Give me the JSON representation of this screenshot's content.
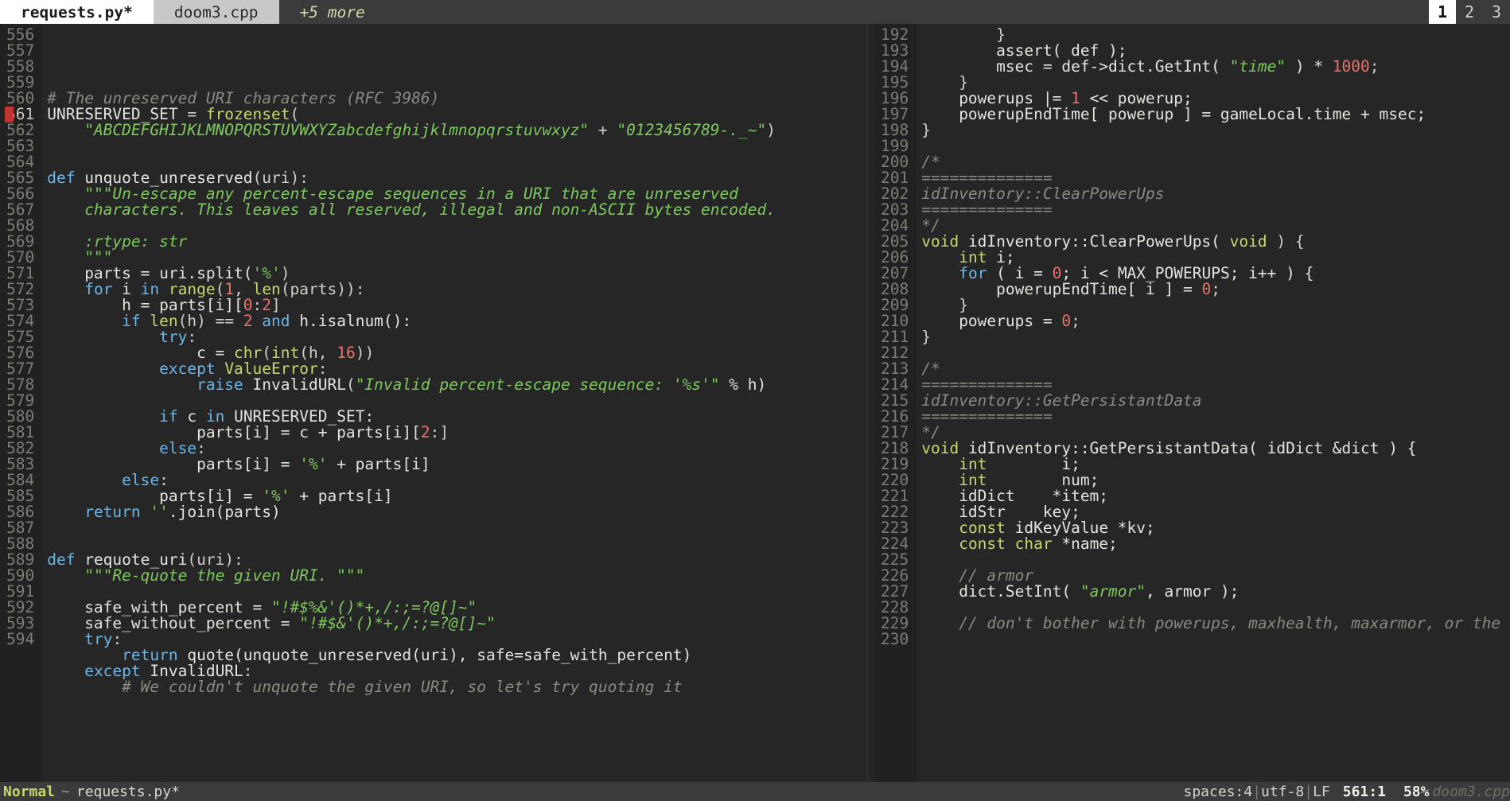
{
  "window": {
    "tabs": [
      {
        "label": "requests.py*",
        "state": "active"
      },
      {
        "label": "doom3.cpp",
        "state": "inactive"
      },
      {
        "label": "+5 more",
        "state": "more"
      }
    ],
    "window_numbers": [
      {
        "label": "1",
        "state": "active"
      },
      {
        "label": "2",
        "state": "inactive"
      },
      {
        "label": "3",
        "state": "inactive"
      }
    ],
    "colors": {
      "background": "#262626",
      "gutter": "#212121",
      "tabbar": "#3b3b3b",
      "statusbar": "#3b3b3b",
      "accent_string": "#7ec95e",
      "accent_keyword": "#6cb6e8",
      "accent_type": "#c5d86d",
      "accent_number": "#e8736b",
      "comment": "#8a8a82",
      "cursor": "#c2322e"
    }
  },
  "statusbar": {
    "mode": "Normal",
    "separator": "~",
    "filename": "requests.py*",
    "indent": "spaces:4",
    "encoding": "utf-8",
    "line_ending": "LF",
    "position": "561:1",
    "scroll_percent": "58%",
    "inactive_pane_file": "doom3.cpp"
  },
  "left_pane": {
    "language": "python",
    "first_line_number": 556,
    "cursor_line": 561,
    "lines": [
      {
        "n": 556,
        "tokens": []
      },
      {
        "n": 557,
        "tokens": [
          {
            "t": "# The unreserved URI characters (RFC 3986)",
            "c": "c"
          }
        ]
      },
      {
        "n": 558,
        "tokens": [
          {
            "t": "UNRESERVED_SET ",
            "c": "t"
          },
          {
            "t": "= ",
            "c": "p"
          },
          {
            "t": "frozenset",
            "c": "kw"
          },
          {
            "t": "(",
            "c": "p"
          }
        ]
      },
      {
        "n": 559,
        "tokens": [
          {
            "t": "    ",
            "c": "t"
          },
          {
            "t": "\"ABCDEFGHIJKLMNOPQRSTUVWXYZabcdefghijklmnopqrstuvwxyz\"",
            "c": "s"
          },
          {
            "t": " + ",
            "c": "p"
          },
          {
            "t": "\"0123456789-._~\"",
            "c": "s"
          },
          {
            "t": ")",
            "c": "p"
          }
        ]
      },
      {
        "n": 560,
        "tokens": []
      },
      {
        "n": 561,
        "tokens": []
      },
      {
        "n": 562,
        "tokens": [
          {
            "t": "def ",
            "c": "k"
          },
          {
            "t": "unquote_unreserved",
            "c": "t"
          },
          {
            "t": "(uri):",
            "c": "p"
          }
        ]
      },
      {
        "n": 563,
        "tokens": [
          {
            "t": "    ",
            "c": "t"
          },
          {
            "t": "\"\"\"Un-escape any percent-escape sequences in a URI that are unreserved",
            "c": "d"
          }
        ]
      },
      {
        "n": 564,
        "tokens": [
          {
            "t": "    characters. This leaves all reserved, illegal and non-ASCII bytes encoded.",
            "c": "d"
          }
        ]
      },
      {
        "n": 565,
        "tokens": []
      },
      {
        "n": 566,
        "tokens": [
          {
            "t": "    :rtype: str",
            "c": "d"
          }
        ]
      },
      {
        "n": 567,
        "tokens": [
          {
            "t": "    \"\"\"",
            "c": "d"
          }
        ]
      },
      {
        "n": 568,
        "tokens": [
          {
            "t": "    parts = uri.split(",
            "c": "t"
          },
          {
            "t": "'%'",
            "c": "s"
          },
          {
            "t": ")",
            "c": "p"
          }
        ]
      },
      {
        "n": 569,
        "tokens": [
          {
            "t": "    ",
            "c": "t"
          },
          {
            "t": "for ",
            "c": "k"
          },
          {
            "t": "i ",
            "c": "t"
          },
          {
            "t": "in ",
            "c": "k"
          },
          {
            "t": "range",
            "c": "kw"
          },
          {
            "t": "(",
            "c": "p"
          },
          {
            "t": "1",
            "c": "n"
          },
          {
            "t": ", ",
            "c": "p"
          },
          {
            "t": "len",
            "c": "kw"
          },
          {
            "t": "(parts)):",
            "c": "p"
          }
        ]
      },
      {
        "n": 570,
        "tokens": [
          {
            "t": "        h = parts[i][",
            "c": "t"
          },
          {
            "t": "0",
            "c": "n"
          },
          {
            "t": ":",
            "c": "p"
          },
          {
            "t": "2",
            "c": "n"
          },
          {
            "t": "]",
            "c": "p"
          }
        ]
      },
      {
        "n": 571,
        "tokens": [
          {
            "t": "        ",
            "c": "t"
          },
          {
            "t": "if ",
            "c": "k"
          },
          {
            "t": "len",
            "c": "kw"
          },
          {
            "t": "(h) == ",
            "c": "p"
          },
          {
            "t": "2 ",
            "c": "n"
          },
          {
            "t": "and ",
            "c": "k"
          },
          {
            "t": "h.isalnum():",
            "c": "t"
          }
        ]
      },
      {
        "n": 572,
        "tokens": [
          {
            "t": "            ",
            "c": "t"
          },
          {
            "t": "try",
            "c": "k"
          },
          {
            "t": ":",
            "c": "p"
          }
        ]
      },
      {
        "n": 573,
        "tokens": [
          {
            "t": "                c = ",
            "c": "t"
          },
          {
            "t": "chr",
            "c": "kw"
          },
          {
            "t": "(",
            "c": "p"
          },
          {
            "t": "int",
            "c": "kw"
          },
          {
            "t": "(h, ",
            "c": "p"
          },
          {
            "t": "16",
            "c": "n"
          },
          {
            "t": "))",
            "c": "p"
          }
        ]
      },
      {
        "n": 574,
        "tokens": [
          {
            "t": "            ",
            "c": "t"
          },
          {
            "t": "except ",
            "c": "k"
          },
          {
            "t": "ValueError",
            "c": "kw"
          },
          {
            "t": ":",
            "c": "p"
          }
        ]
      },
      {
        "n": 575,
        "tokens": [
          {
            "t": "                ",
            "c": "t"
          },
          {
            "t": "raise ",
            "c": "k"
          },
          {
            "t": "InvalidURL",
            "c": "t"
          },
          {
            "t": "(",
            "c": "p"
          },
          {
            "t": "\"Invalid percent-escape sequence: '%s'\"",
            "c": "s"
          },
          {
            "t": " % h)",
            "c": "t"
          }
        ]
      },
      {
        "n": 576,
        "tokens": []
      },
      {
        "n": 577,
        "tokens": [
          {
            "t": "            ",
            "c": "t"
          },
          {
            "t": "if ",
            "c": "k"
          },
          {
            "t": "c ",
            "c": "t"
          },
          {
            "t": "in ",
            "c": "k"
          },
          {
            "t": "UNRESERVED_SET:",
            "c": "t"
          }
        ]
      },
      {
        "n": 578,
        "tokens": [
          {
            "t": "                parts[i] = c + parts[i][",
            "c": "t"
          },
          {
            "t": "2",
            "c": "n"
          },
          {
            "t": ":]",
            "c": "p"
          }
        ]
      },
      {
        "n": 579,
        "tokens": [
          {
            "t": "            ",
            "c": "t"
          },
          {
            "t": "else",
            "c": "k"
          },
          {
            "t": ":",
            "c": "p"
          }
        ]
      },
      {
        "n": 580,
        "tokens": [
          {
            "t": "                parts[i] = ",
            "c": "t"
          },
          {
            "t": "'%'",
            "c": "s"
          },
          {
            "t": " + parts[i]",
            "c": "t"
          }
        ]
      },
      {
        "n": 581,
        "tokens": [
          {
            "t": "        ",
            "c": "t"
          },
          {
            "t": "else",
            "c": "k"
          },
          {
            "t": ":",
            "c": "p"
          }
        ]
      },
      {
        "n": 582,
        "tokens": [
          {
            "t": "            parts[i] = ",
            "c": "t"
          },
          {
            "t": "'%'",
            "c": "s"
          },
          {
            "t": " + parts[i]",
            "c": "t"
          }
        ]
      },
      {
        "n": 583,
        "tokens": [
          {
            "t": "    ",
            "c": "t"
          },
          {
            "t": "return ",
            "c": "k"
          },
          {
            "t": "''",
            "c": "s"
          },
          {
            "t": ".join(parts)",
            "c": "t"
          }
        ]
      },
      {
        "n": 584,
        "tokens": []
      },
      {
        "n": 585,
        "tokens": []
      },
      {
        "n": 586,
        "tokens": [
          {
            "t": "def ",
            "c": "k"
          },
          {
            "t": "requote_uri",
            "c": "t"
          },
          {
            "t": "(uri):",
            "c": "p"
          }
        ]
      },
      {
        "n": 587,
        "tokens": [
          {
            "t": "    ",
            "c": "t"
          },
          {
            "t": "\"\"\"Re-quote the given URI. \"\"\"",
            "c": "d"
          }
        ]
      },
      {
        "n": 588,
        "tokens": []
      },
      {
        "n": 589,
        "tokens": [
          {
            "t": "    safe_with_percent = ",
            "c": "t"
          },
          {
            "t": "\"!#$%&'()*+,/:;=?@[]~\"",
            "c": "s"
          }
        ]
      },
      {
        "n": 590,
        "tokens": [
          {
            "t": "    safe_without_percent = ",
            "c": "t"
          },
          {
            "t": "\"!#$&'()*+,/:;=?@[]~\"",
            "c": "s"
          }
        ]
      },
      {
        "n": 591,
        "tokens": [
          {
            "t": "    ",
            "c": "t"
          },
          {
            "t": "try",
            "c": "k"
          },
          {
            "t": ":",
            "c": "p"
          }
        ]
      },
      {
        "n": 592,
        "tokens": [
          {
            "t": "        ",
            "c": "t"
          },
          {
            "t": "return ",
            "c": "k"
          },
          {
            "t": "quote(unquote_unreserved(uri), safe=safe_with_percent)",
            "c": "t"
          }
        ]
      },
      {
        "n": 593,
        "tokens": [
          {
            "t": "    ",
            "c": "t"
          },
          {
            "t": "except ",
            "c": "k"
          },
          {
            "t": "InvalidURL",
            "c": "t"
          },
          {
            "t": ":",
            "c": "p"
          }
        ]
      },
      {
        "n": 594,
        "tokens": [
          {
            "t": "        # We couldn't unquote the given URI, so let's try quoting it",
            "c": "c"
          }
        ]
      }
    ]
  },
  "right_pane": {
    "language": "cpp",
    "first_line_number": 192,
    "lines": [
      {
        "n": 192,
        "tokens": [
          {
            "t": "\t\t}",
            "c": "p"
          }
        ]
      },
      {
        "n": 193,
        "tokens": [
          {
            "t": "\t\tassert( def );",
            "c": "t"
          }
        ]
      },
      {
        "n": 194,
        "tokens": [
          {
            "t": "\t\tmsec = def->dict.GetInt( ",
            "c": "t"
          },
          {
            "t": "\"time\"",
            "c": "s"
          },
          {
            "t": " ) * ",
            "c": "t"
          },
          {
            "t": "1000",
            "c": "n"
          },
          {
            "t": ";",
            "c": "p"
          }
        ]
      },
      {
        "n": 195,
        "tokens": [
          {
            "t": "\t}",
            "c": "p"
          }
        ]
      },
      {
        "n": 196,
        "tokens": [
          {
            "t": "\tpowerups |= ",
            "c": "t"
          },
          {
            "t": "1",
            "c": "n"
          },
          {
            "t": " << powerup;",
            "c": "t"
          }
        ]
      },
      {
        "n": 197,
        "tokens": [
          {
            "t": "\tpowerupEndTime[ powerup ] = gameLocal.time + msec;",
            "c": "t"
          }
        ]
      },
      {
        "n": 198,
        "tokens": [
          {
            "t": "}",
            "c": "p"
          }
        ]
      },
      {
        "n": 199,
        "tokens": []
      },
      {
        "n": 200,
        "tokens": [
          {
            "t": "/*",
            "c": "c"
          }
        ]
      },
      {
        "n": 201,
        "tokens": [
          {
            "t": "==============",
            "c": "c"
          }
        ]
      },
      {
        "n": 202,
        "tokens": [
          {
            "t": "idInventory::ClearPowerUps",
            "c": "c"
          }
        ]
      },
      {
        "n": 203,
        "tokens": [
          {
            "t": "==============",
            "c": "c"
          }
        ]
      },
      {
        "n": 204,
        "tokens": [
          {
            "t": "*/",
            "c": "c"
          }
        ]
      },
      {
        "n": 205,
        "tokens": [
          {
            "t": "void ",
            "c": "kw"
          },
          {
            "t": "idInventory::ClearPowerUps( ",
            "c": "t"
          },
          {
            "t": "void ",
            "c": "kw"
          },
          {
            "t": ") {",
            "c": "p"
          }
        ]
      },
      {
        "n": 206,
        "tokens": [
          {
            "t": "\t",
            "c": "t"
          },
          {
            "t": "int ",
            "c": "kw"
          },
          {
            "t": "i;",
            "c": "t"
          }
        ]
      },
      {
        "n": 207,
        "tokens": [
          {
            "t": "\t",
            "c": "t"
          },
          {
            "t": "for ",
            "c": "k"
          },
          {
            "t": "( i = ",
            "c": "t"
          },
          {
            "t": "0",
            "c": "n"
          },
          {
            "t": "; i < MAX_POWERUPS; i++ ) {",
            "c": "t"
          }
        ]
      },
      {
        "n": 208,
        "tokens": [
          {
            "t": "\t\tpowerupEndTime[ i ] = ",
            "c": "t"
          },
          {
            "t": "0",
            "c": "n"
          },
          {
            "t": ";",
            "c": "p"
          }
        ]
      },
      {
        "n": 209,
        "tokens": [
          {
            "t": "\t}",
            "c": "p"
          }
        ]
      },
      {
        "n": 210,
        "tokens": [
          {
            "t": "\tpowerups = ",
            "c": "t"
          },
          {
            "t": "0",
            "c": "n"
          },
          {
            "t": ";",
            "c": "p"
          }
        ]
      },
      {
        "n": 211,
        "tokens": [
          {
            "t": "}",
            "c": "p"
          }
        ]
      },
      {
        "n": 212,
        "tokens": []
      },
      {
        "n": 213,
        "tokens": [
          {
            "t": "/*",
            "c": "c"
          }
        ]
      },
      {
        "n": 214,
        "tokens": [
          {
            "t": "==============",
            "c": "c"
          }
        ]
      },
      {
        "n": 215,
        "tokens": [
          {
            "t": "idInventory::GetPersistantData",
            "c": "c"
          }
        ]
      },
      {
        "n": 216,
        "tokens": [
          {
            "t": "==============",
            "c": "c"
          }
        ]
      },
      {
        "n": 217,
        "tokens": [
          {
            "t": "*/",
            "c": "c"
          }
        ]
      },
      {
        "n": 218,
        "tokens": [
          {
            "t": "void ",
            "c": "kw"
          },
          {
            "t": "idInventory::GetPersistantData( idDict &dict ) {",
            "c": "t"
          }
        ]
      },
      {
        "n": 219,
        "tokens": [
          {
            "t": "\t",
            "c": "t"
          },
          {
            "t": "int",
            "c": "kw"
          },
          {
            "t": "\t\ti;",
            "c": "t"
          }
        ]
      },
      {
        "n": 220,
        "tokens": [
          {
            "t": "\t",
            "c": "t"
          },
          {
            "t": "int",
            "c": "kw"
          },
          {
            "t": "\t\tnum;",
            "c": "t"
          }
        ]
      },
      {
        "n": 221,
        "tokens": [
          {
            "t": "\tidDict\t*item;",
            "c": "t"
          }
        ]
      },
      {
        "n": 222,
        "tokens": [
          {
            "t": "\tidStr\tkey;",
            "c": "t"
          }
        ]
      },
      {
        "n": 223,
        "tokens": [
          {
            "t": "\t",
            "c": "t"
          },
          {
            "t": "const ",
            "c": "kw"
          },
          {
            "t": "idKeyValue *kv;",
            "c": "t"
          }
        ]
      },
      {
        "n": 224,
        "tokens": [
          {
            "t": "\t",
            "c": "t"
          },
          {
            "t": "const char ",
            "c": "kw"
          },
          {
            "t": "*name;",
            "c": "t"
          }
        ]
      },
      {
        "n": 225,
        "tokens": []
      },
      {
        "n": 226,
        "tokens": [
          {
            "t": "\t// armor",
            "c": "c"
          }
        ]
      },
      {
        "n": 227,
        "tokens": [
          {
            "t": "\tdict.SetInt( ",
            "c": "t"
          },
          {
            "t": "\"armor\"",
            "c": "s"
          },
          {
            "t": ", armor );",
            "c": "t"
          }
        ]
      },
      {
        "n": 228,
        "tokens": []
      },
      {
        "n": 229,
        "tokens": [
          {
            "t": "\t// don't bother with powerups, maxhealth, maxarmor, or the",
            "c": "c"
          }
        ]
      },
      {
        "n": 230,
        "tokens": []
      }
    ]
  }
}
